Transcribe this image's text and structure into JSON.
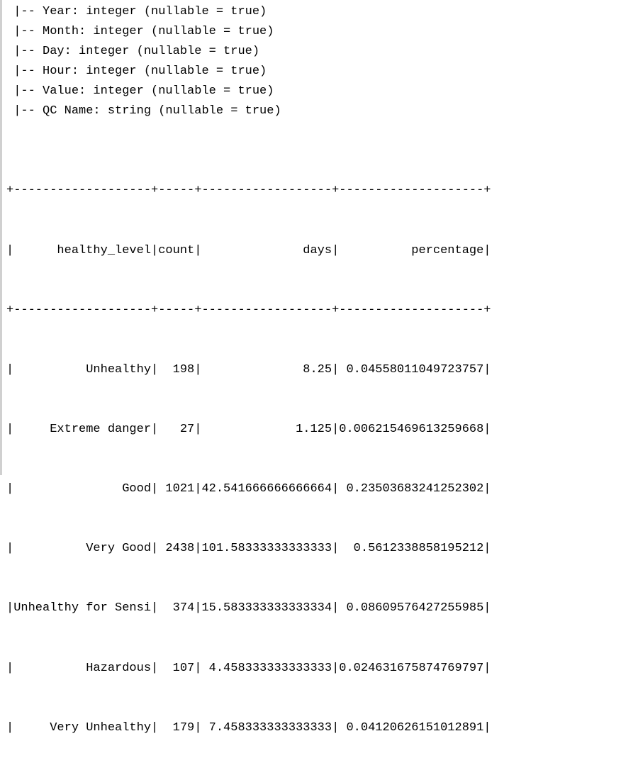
{
  "schema": {
    "fields": [
      " |-- Year: integer (nullable = true)",
      " |-- Month: integer (nullable = true)",
      " |-- Day: integer (nullable = true)",
      " |-- Hour: integer (nullable = true)",
      " |-- Value: integer (nullable = true)",
      " |-- QC Name: string (nullable = true)"
    ]
  },
  "table": {
    "border": "+-------------------+-----+------------------+--------------------+",
    "header": "|      healthy_level|count|              days|          percentage|",
    "rows": [
      "|          Unhealthy|  198|              8.25| 0.04558011049723757|",
      "|     Extreme danger|   27|             1.125|0.006215469613259668|",
      "|               Good| 1021|42.541666666666664| 0.23503683241252302|",
      "|          Very Good| 2438|101.58333333333333|  0.5612338858195212|",
      "|Unhealthy for Sensi|  374|15.583333333333334| 0.08609576427255985|",
      "|          Hazardous|  107| 4.458333333333333|0.024631675874769797|",
      "|     Very Unhealthy|  179| 7.458333333333333| 0.04120626151012891|"
    ]
  }
}
